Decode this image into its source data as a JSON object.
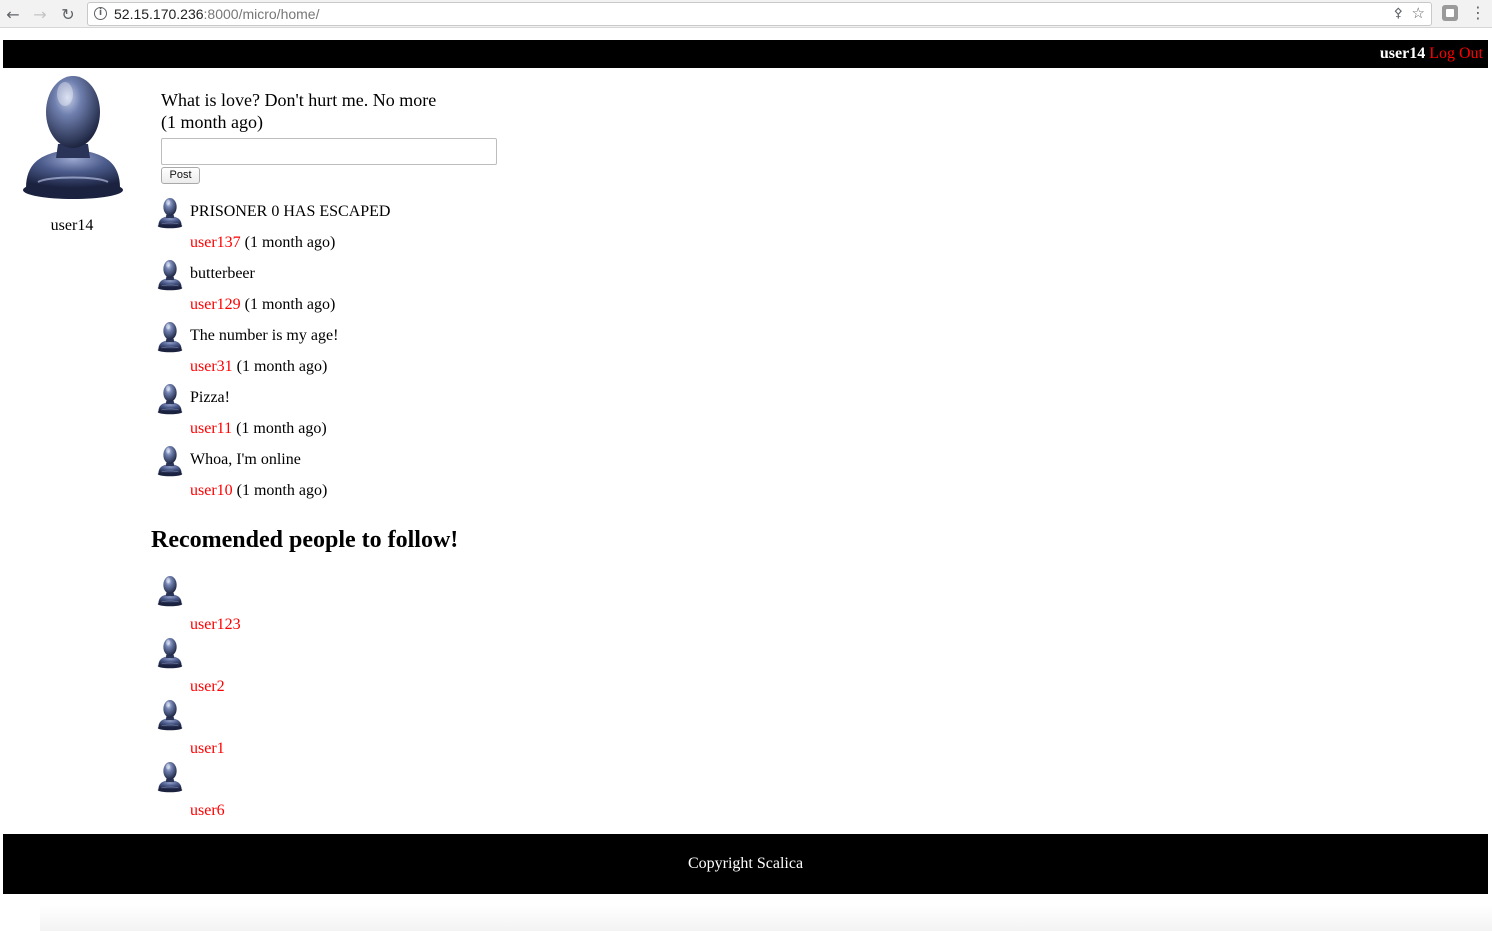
{
  "browser": {
    "url_host": "52.15.170.236",
    "url_rest": ":8000/micro/home/",
    "icons": [
      "back-arrow-icon",
      "forward-arrow-icon",
      "reload-icon",
      "info-icon",
      "key-icon",
      "star-icon",
      "extension-icon",
      "menu-dots-icon"
    ]
  },
  "header": {
    "username": "user14",
    "logout_label": "Log Out"
  },
  "profile": {
    "username": "user14"
  },
  "latest_post": {
    "text": "What is love? Don't hurt me. No more",
    "time": "(1 month ago)"
  },
  "composer": {
    "input_value": "",
    "post_label": "Post"
  },
  "feed": [
    {
      "text": "PRISONER 0 HAS ESCAPED",
      "user": "user137",
      "time": "(1 month ago)"
    },
    {
      "text": "butterbeer",
      "user": "user129",
      "time": "(1 month ago)"
    },
    {
      "text": "The number is my age!",
      "user": "user31",
      "time": "(1 month ago)"
    },
    {
      "text": "Pizza!",
      "user": "user11",
      "time": "(1 month ago)"
    },
    {
      "text": "Whoa, I'm online",
      "user": "user10",
      "time": "(1 month ago)"
    }
  ],
  "recommendations": {
    "heading": "Recomended people to follow!",
    "users": [
      {
        "user": "user123"
      },
      {
        "user": "user2"
      },
      {
        "user": "user1"
      },
      {
        "user": "user6"
      }
    ]
  },
  "footer": {
    "text": "Copyright Scalica"
  },
  "colors": {
    "link": "#ff0000",
    "bar": "#000000",
    "avatar": "#4a5a85"
  }
}
